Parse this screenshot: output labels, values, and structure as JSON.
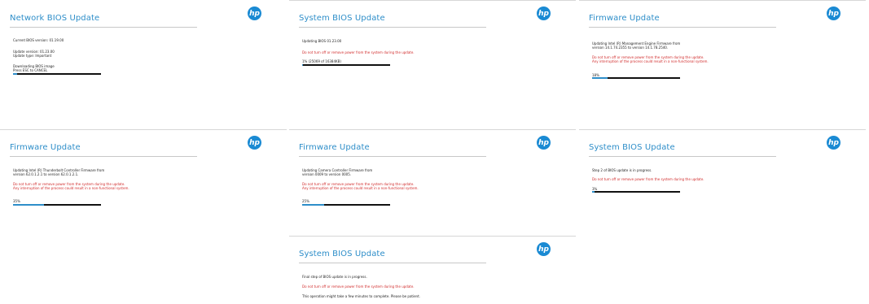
{
  "hp_logo_text": "hp",
  "colors": {
    "accent": "#2e8ec9",
    "warning": "#d12b2b",
    "bar_track": "#111111"
  },
  "panels": [
    {
      "title": "Network BIOS Update",
      "lines": [
        "Current BIOS version: 01.19.00",
        "Update version: 01.23.00",
        "Update type: Important",
        "Downloading BIOS image",
        "Press ESC to CANCEL"
      ],
      "progress_fraction": 0.05
    },
    {
      "title": "System BIOS Update",
      "lines": [
        "Updating BIOS 01.23.00",
        "Do not turn off or remove power from the system during the update.",
        "1% (25069 of 16384KB)"
      ],
      "progress_fraction": 0.01
    },
    {
      "title": "Firmware Update",
      "lines": [
        "Updating Intel (R) Management Engine Firmware from",
        "version 14.1.74.2355 to version 14.1.78.2540.",
        "Do not turn off or remove power from the system during the update.",
        "Any interruption of the process could result in a non-functional system.",
        "18%"
      ],
      "progress_fraction": 0.18
    },
    {
      "title": "Firmware Update",
      "lines": [
        "Updating Intel (R) Thunderbolt Controller Firmware from",
        "version 62.0.1.2.1 to version 62.0.1.2.1.",
        "Do not turn off or remove power from the system during the update.",
        "Any interruption of the process could result in a non-functional system.",
        "35%"
      ],
      "progress_fraction": 0.35
    },
    {
      "title": "Firmware Update",
      "lines": [
        "Updating Camera Controller Firmware from",
        "version 0009 to version 0005.",
        "Do not turn off or remove power from the system during the update.",
        "Any interruption of the process could result in a non-functional system.",
        "25%"
      ],
      "progress_fraction": 0.25
    },
    {
      "title": "System BIOS Update",
      "lines": [
        "Step 2 of BIOS update is in progress.",
        "Do not turn off or remove power from the system during the update.",
        "3%"
      ],
      "progress_fraction": 0.03
    },
    {
      "title": "System BIOS Update",
      "lines": [
        "Final step of BIOS update is in progress.",
        "Do not turn off or remove power from the system during the update.",
        "This operation might take a few minutes to complete. Please be patient."
      ]
    }
  ]
}
